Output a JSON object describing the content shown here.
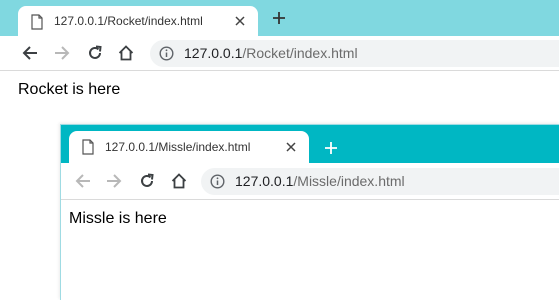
{
  "rocket_window": {
    "tab_title": "127.0.0.1/Rocket/index.html",
    "url_host": "127.0.0.1",
    "url_path": "/Rocket/index.html",
    "page_text": "Rocket is here",
    "tabstrip_color": "#80d8e0"
  },
  "missle_window": {
    "tab_title": "127.0.0.1/Missle/index.html",
    "url_host": "127.0.0.1",
    "url_path": "/Missle/index.html",
    "page_text": "Missle is here",
    "tabstrip_color": "#00b7c3"
  },
  "icons": {
    "tab": "document-icon",
    "close": "close-icon",
    "new_tab": "plus-icon",
    "back": "back-arrow-icon",
    "forward": "forward-arrow-icon",
    "reload": "reload-icon",
    "home": "home-icon",
    "site_info": "info-icon"
  }
}
